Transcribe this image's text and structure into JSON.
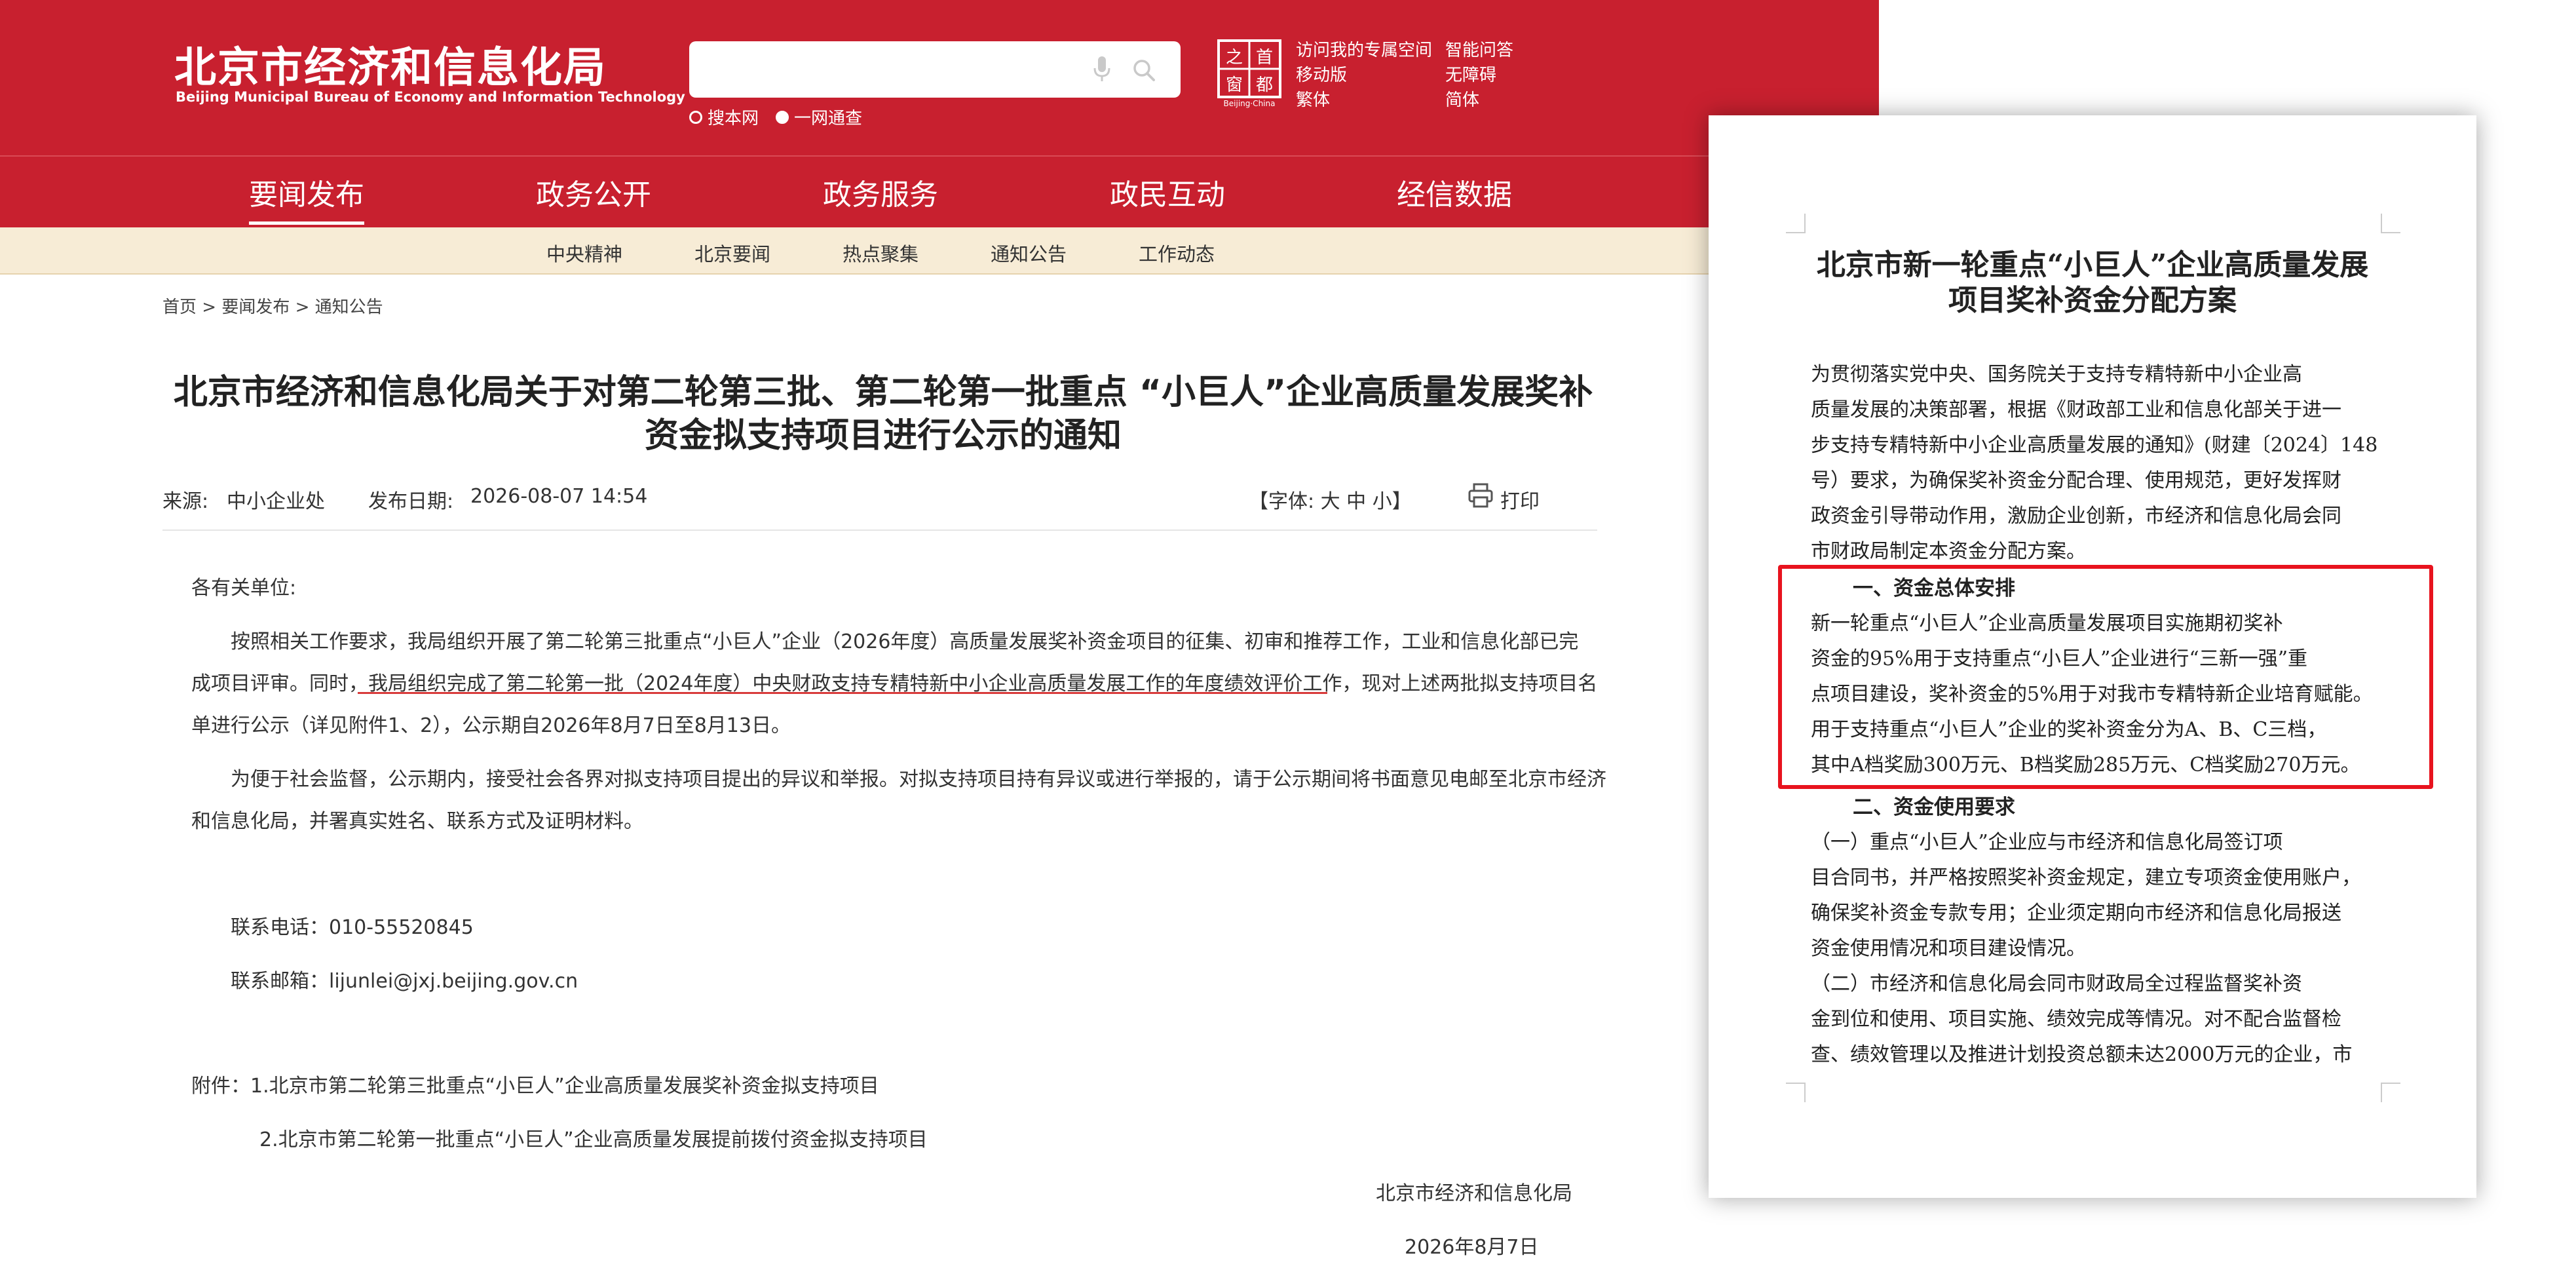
{
  "header": {
    "logo_cn": "北京市经济和信息化局",
    "logo_en": "Beijing Municipal Bureau of Economy and Information Technology",
    "search_placeholder": "",
    "scope_options": [
      "搜本网",
      "一网通查"
    ],
    "emblem_text": "首都之窗",
    "emblem_en": "Beijing·China",
    "util_links_col1": [
      "访问我的专属空间",
      "移动版",
      "繁体"
    ],
    "util_links_col2": [
      "智能问答",
      "无障碍",
      "简体"
    ]
  },
  "nav": {
    "items": [
      "要闻发布",
      "政务公开",
      "政务服务",
      "政民互动",
      "经信数据"
    ],
    "active_index": 0
  },
  "subnav": {
    "items": [
      "中央精神",
      "北京要闻",
      "热点聚集",
      "通知公告",
      "工作动态"
    ]
  },
  "breadcrumb": "首页 > 要闻发布 > 通知公告",
  "article": {
    "title_line1": "北京市经济和信息化局关于对第二轮第三批、第二轮第一批重点 “小巨人”企业高质量发展奖补",
    "title_line2": "资金拟支持项目进行公示的通知",
    "source_label": "来源:",
    "source_value": "中小企业处",
    "date_label": "发布日期:",
    "date_value": "2026-08-07 14:54",
    "font_size_label": "【字体: 大 中 小】",
    "print_label": "打印",
    "salutation": "各有关单位:",
    "p1_line1": "按照相关工作要求，我局组织开展了第二轮第三批重点“小巨人”企业（2026年度）高质量发展奖补资金项目的征集、初审和推荐工作，工业和信息化部已完",
    "p1_line2": "成项目评审。同时，我局组织完成了第二轮第一批（2024年度）中央财政支持专精特新中小企业高质量发展工作的年度绩效评价工作，现对上述两批拟支持项目名",
    "p1_line3": "单进行公示（详见附件1、2），公示期自2026年8月7日至8月13日。",
    "p2_line1": "为便于社会监督，公示期内，接受社会各界对拟支持项目提出的异议和举报。对拟支持项目持有异议或进行举报的，请于公示期间将书面意见电邮至北京市经济",
    "p2_line2": "和信息化局，并署真实姓名、联系方式及证明材料。",
    "phone": "联系电话：010-55520845",
    "email": "联系邮箱：lijunlei@jxj.beijing.gov.cn",
    "attach1": "附件：1.北京市第二轮第三批重点“小巨人”企业高质量发展奖补资金拟支持项目",
    "attach2": "2.北京市第二轮第一批重点“小巨人”企业高质量发展提前拨付资金拟支持项目",
    "signature": "北京市经济和信息化局",
    "sign_date": "2026年8月7日"
  },
  "document": {
    "title_line1": "北京市新一轮重点“小巨人”企业高质量发展",
    "title_line2": "项目奖补资金分配方案",
    "lines": [
      "    为贯彻落实党中央、国务院关于支持专精特新中小企业高",
      "质量发展的决策部署，根据《财政部工业和信息化部关于进一",
      "步支持专精特新中小企业高质量发展的通知》(财建〔2024〕148",
      "号）要求，为确保奖补资金分配合理、使用规范，更好发挥财",
      "政资金引导带动作用，激励企业创新，市经济和信息化局会同",
      "市财政局制定本资金分配方案。"
    ],
    "heading1": "一、资金总体安排",
    "section1": [
      "    新一轮重点“小巨人”企业高质量发展项目实施期初奖补",
      "资金的95%用于支持重点“小巨人”企业进行“三新一强”重",
      "点项目建设，奖补资金的5%用于对我市专精特新企业培育赋能。",
      "用于支持重点“小巨人”企业的奖补资金分为A、B、C三档，",
      "其中A档奖励300万元、B档奖励285万元、C档奖励270万元。"
    ],
    "heading2": "二、资金使用要求",
    "section2": [
      "    （一）重点“小巨人”企业应与市经济和信息化局签订项",
      "目合同书，并严格按照奖补资金规定，建立专项资金使用账户，",
      "确保奖补资金专款专用；企业须定期向市经济和信息化局报送",
      "资金使用情况和项目建设情况。",
      "    （二）市经济和信息化局会同市财政局全过程监督奖补资",
      "金到位和使用、项目实施、绩效完成等情况。对不配合监督检",
      "查、绩效管理以及推进计划投资总额未达2000万元的企业，市"
    ]
  },
  "colors": {
    "brand_red": "#c8202f",
    "subnav_bg": "#f7ecd6",
    "highlight_red": "#e8131e"
  }
}
